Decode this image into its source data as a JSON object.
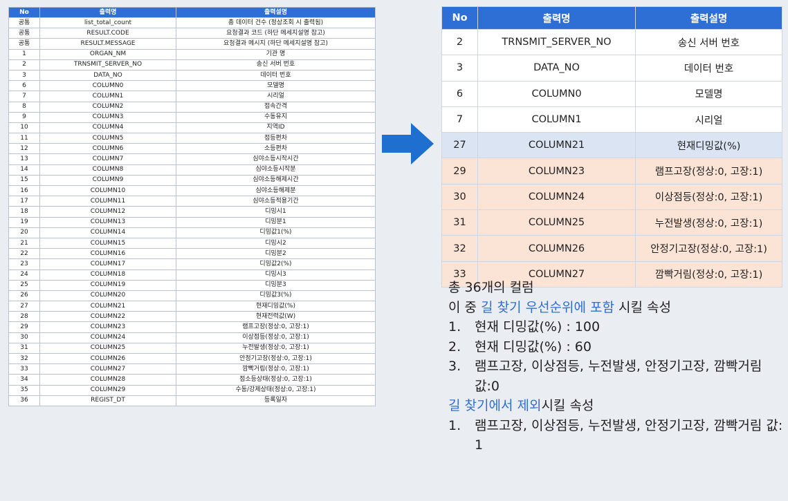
{
  "left_table": {
    "headers": [
      "No",
      "출력명",
      "출력설명"
    ],
    "rows": [
      [
        "공통",
        "list_total_count",
        "총 데이터 건수 (정상조회 시 출력됨)"
      ],
      [
        "공통",
        "RESULT.CODE",
        "요청결과 코드 (하단 메세지설명 참고)"
      ],
      [
        "공통",
        "RESULT.MESSAGE",
        "요청결과 메시지 (하단 메세지설명 참고)"
      ],
      [
        "1",
        "ORGAN_NM",
        "기관 명"
      ],
      [
        "2",
        "TRNSMIT_SERVER_NO",
        "송신 서버 번호"
      ],
      [
        "3",
        "DATA_NO",
        "데이터 번호"
      ],
      [
        "6",
        "COLUMN0",
        "모델명"
      ],
      [
        "7",
        "COLUMN1",
        "시리얼"
      ],
      [
        "8",
        "COLUMN2",
        "접속간격"
      ],
      [
        "9",
        "COLUMN3",
        "수동유지"
      ],
      [
        "10",
        "COLUMN4",
        "지역ID"
      ],
      [
        "11",
        "COLUMN5",
        "점등편차"
      ],
      [
        "12",
        "COLUMN6",
        "소등편차"
      ],
      [
        "13",
        "COLUMN7",
        "심야소등시작시간"
      ],
      [
        "14",
        "COLUMN8",
        "심야소등시작분"
      ],
      [
        "15",
        "COLUMN9",
        "심야소등해제시간"
      ],
      [
        "16",
        "COLUMN10",
        "심야소등해제분"
      ],
      [
        "17",
        "COLUMN11",
        "심야소등적용기간"
      ],
      [
        "18",
        "COLUMN12",
        "디밍시1"
      ],
      [
        "19",
        "COLUMN13",
        "디밍분1"
      ],
      [
        "20",
        "COLUMN14",
        "디밍값1(%)"
      ],
      [
        "21",
        "COLUMN15",
        "디밍시2"
      ],
      [
        "22",
        "COLUMN16",
        "디밍분2"
      ],
      [
        "23",
        "COLUMN17",
        "디밍값2(%)"
      ],
      [
        "24",
        "COLUMN18",
        "디밍시3"
      ],
      [
        "25",
        "COLUMN19",
        "디밍분3"
      ],
      [
        "26",
        "COLUMN20",
        "디밍값3(%)"
      ],
      [
        "27",
        "COLUMN21",
        "현재디밍값(%)"
      ],
      [
        "28",
        "COLUMN22",
        "현재전력값(W)"
      ],
      [
        "29",
        "COLUMN23",
        "램프고장(정상:0, 고장:1)"
      ],
      [
        "30",
        "COLUMN24",
        "이상점등(정상:0, 고장:1)"
      ],
      [
        "31",
        "COLUMN25",
        "누전발생(정상:0, 고장:1)"
      ],
      [
        "32",
        "COLUMN26",
        "안정기고장(정상:0, 고장:1)"
      ],
      [
        "33",
        "COLUMN27",
        "깜빡거림(정상:0, 고장:1)"
      ],
      [
        "34",
        "COLUMN28",
        "점소등상태(정상:0, 고장:1)"
      ],
      [
        "35",
        "COLUMN29",
        "수동/강제상태(정상:0, 고장:1)"
      ],
      [
        "36",
        "REGIST_DT",
        "등록일자"
      ]
    ]
  },
  "right_table": {
    "headers": [
      "No",
      "출력명",
      "출력설명"
    ],
    "rows": [
      {
        "cells": [
          "2",
          "TRNSMIT_SERVER_NO",
          "송신 서버 번호"
        ],
        "highlight": "none"
      },
      {
        "cells": [
          "3",
          "DATA_NO",
          "데이터 번호"
        ],
        "highlight": "none"
      },
      {
        "cells": [
          "6",
          "COLUMN0",
          "모델명"
        ],
        "highlight": "none"
      },
      {
        "cells": [
          "7",
          "COLUMN1",
          "시리얼"
        ],
        "highlight": "none"
      },
      {
        "cells": [
          "27",
          "COLUMN21",
          "현재디밍값(%)"
        ],
        "highlight": "blue"
      },
      {
        "cells": [
          "29",
          "COLUMN23",
          "램프고장(정상:0, 고장:1)"
        ],
        "highlight": "peach"
      },
      {
        "cells": [
          "30",
          "COLUMN24",
          "이상점등(정상:0, 고장:1)"
        ],
        "highlight": "peach"
      },
      {
        "cells": [
          "31",
          "COLUMN25",
          "누전발생(정상:0, 고장:1)"
        ],
        "highlight": "peach"
      },
      {
        "cells": [
          "32",
          "COLUMN26",
          "안정기고장(정상:0, 고장:1)"
        ],
        "highlight": "peach"
      },
      {
        "cells": [
          "33",
          "COLUMN27",
          "깜빡거림(정상:0, 고장:1)"
        ],
        "highlight": "peach"
      }
    ]
  },
  "notes": {
    "total": "총 36개의 컬럼",
    "include_prefix": "이 중 ",
    "include_accent": "길 찾기 우선순위에 포함",
    "include_suffix": " 시킬 속성",
    "include_items": [
      {
        "num": "1.",
        "text": "현재 디밍값(%) : 100"
      },
      {
        "num": "2.",
        "text": "현재 디밍값(%) : 60"
      },
      {
        "num": "3.",
        "text": "램프고장, 이상점등, 누전발생, 안정기고장, 깜빡거림 값:0"
      }
    ],
    "exclude_accent": "길 찾기에서 제외",
    "exclude_suffix": "시킬 속성",
    "exclude_items": [
      {
        "num": "1.",
        "text": "램프고장, 이상점등, 누전발생, 안정기고장, 깜빡거림 값: 1"
      }
    ]
  },
  "colors": {
    "header_blue": "#2e6fd6",
    "highlight_blue": "#dbe4f3",
    "highlight_peach": "#fbe3d6",
    "accent_text": "#2e6fd6",
    "arrow": "#1f6fd0"
  },
  "icons": {
    "arrow": "right-arrow-icon"
  }
}
